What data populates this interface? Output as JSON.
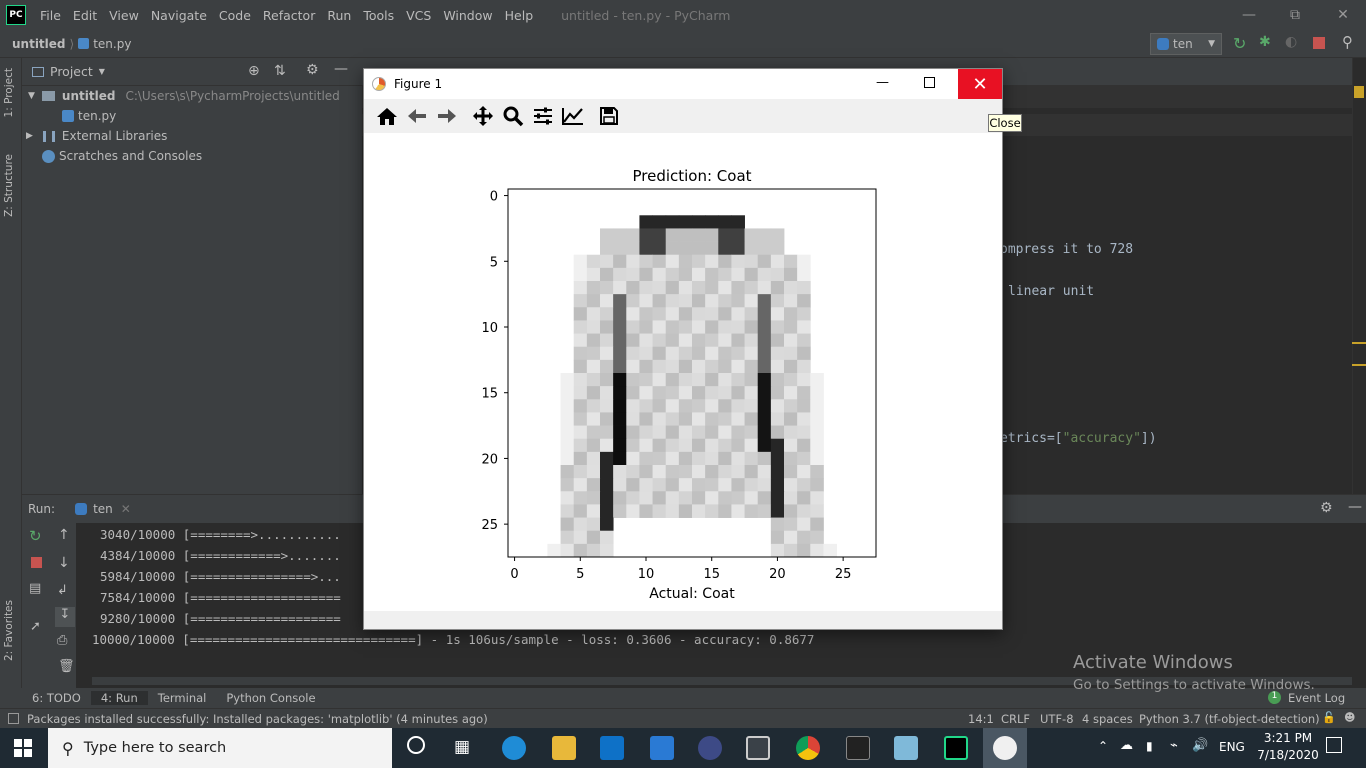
{
  "window": {
    "logo": "PC",
    "title": "untitled - ten.py - PyCharm",
    "menu": [
      "File",
      "Edit",
      "View",
      "Navigate",
      "Code",
      "Refactor",
      "Run",
      "Tools",
      "VCS",
      "Window",
      "Help"
    ]
  },
  "navbar": {
    "project": "untitled",
    "file": "ten.py",
    "run_config": "ten"
  },
  "left_strip": {
    "project_tab": "1: Project",
    "structure_tab": "Z: Structure",
    "favorites_tab": "2: Favorites"
  },
  "project_panel": {
    "header": "Project",
    "tree": [
      {
        "label": "untitled",
        "path": "C:\\Users\\s\\PycharmProjects\\untitled"
      },
      {
        "label": "ten.py"
      },
      {
        "label": "External Libraries"
      },
      {
        "label": "Scratches and Consoles"
      }
    ]
  },
  "editor": {
    "lines": [
      {
        "text": "ompress it to 728"
      },
      {
        "text": "linear unit"
      },
      {
        "text_a": "etrics=[",
        "text_b": "\"accuracy\"",
        "text_c": "])"
      }
    ]
  },
  "run_panel": {
    "label": "Run:",
    "tab": "ten",
    "console": [
      "3040/10000 [========>...........",
      "4384/10000 [============>.......",
      "5984/10000 [================>...",
      "7584/10000 [====================",
      "9280/10000 [====================",
      "10000/10000 [==============================] - 1s 106us/sample - loss: 0.3606 - accuracy: 0.8677"
    ]
  },
  "tool_tabs": [
    "6: TODO",
    "4: Run",
    "Terminal",
    "Python Console"
  ],
  "event_log": {
    "count": "1",
    "label": "Event Log"
  },
  "status": {
    "message": "Packages installed successfully: Installed packages: 'matplotlib' (4 minutes ago)",
    "position": "14:1",
    "line_sep": "CRLF",
    "encoding": "UTF-8",
    "indent": "4 spaces",
    "interpreter": "Python 3.7 (tf-object-detection)"
  },
  "watermark": {
    "line1": "Activate Windows",
    "line2": "Go to Settings to activate Windows."
  },
  "taskbar": {
    "search_placeholder": "Type here to search",
    "language": "ENG",
    "time": "3:21 PM",
    "date": "7/18/2020"
  },
  "figure": {
    "title": "Figure 1",
    "tooltip": "Close",
    "toolbar": [
      "home-icon",
      "back-icon",
      "forward-icon",
      "pan-icon",
      "zoom-icon",
      "configure-icon",
      "edit-axis-icon",
      "save-icon"
    ]
  },
  "chart_data": {
    "type": "heatmap",
    "title": "Prediction: Coat",
    "xlabel": "Actual: Coat",
    "ylabel": "",
    "xticks": [
      "0",
      "5",
      "10",
      "15",
      "20",
      "25"
    ],
    "yticks": [
      "0",
      "5",
      "10",
      "15",
      "20",
      "25"
    ],
    "xlim": [
      -0.5,
      27.5
    ],
    "ylim": [
      27.5,
      -0.5
    ],
    "colormap": "gray_r",
    "rows": 28,
    "cols": 28,
    "grid": false
  }
}
